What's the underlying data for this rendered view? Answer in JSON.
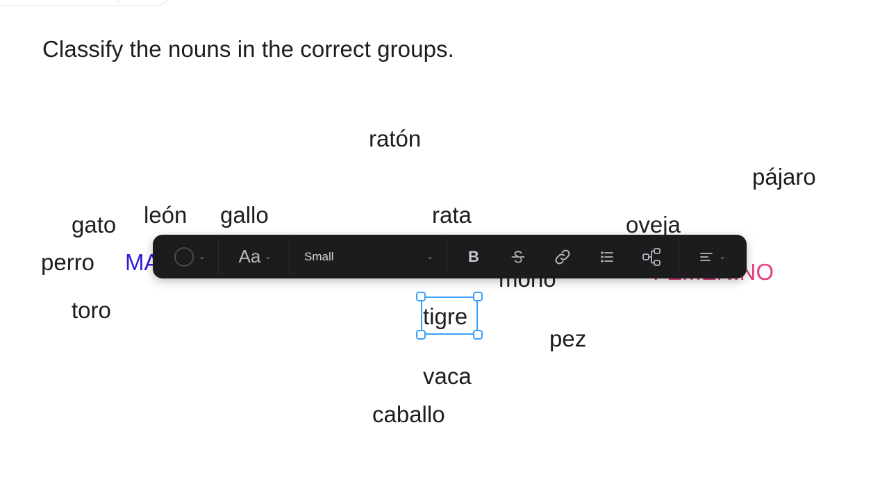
{
  "instructions": "Classify the nouns in the correct groups.",
  "words": {
    "raton": "ratón",
    "pajaro": "pájaro",
    "gato": "gato",
    "leon": "león",
    "gallo": "gallo",
    "rata": "rata",
    "oveja": "oveja",
    "perro": "perro",
    "mono": "mono",
    "toro": "toro",
    "tigre": "tigre",
    "pez": "pez",
    "vaca": "vaca",
    "caballo": "caballo"
  },
  "categories": {
    "masculine_visible": "MA",
    "feminine_visible": "FEMENINO"
  },
  "toolbar": {
    "font_label": "Aa",
    "size_label": "Small",
    "bold_label": "B"
  },
  "icons": {
    "color": "color-circle-icon",
    "strike": "strikethrough-icon",
    "link": "link-icon",
    "list": "bulleted-list-icon",
    "diagram": "diagram-icon",
    "align": "align-left-icon",
    "chevron": "chevron-down-icon"
  },
  "colors": {
    "masculine": "#2f1dd6",
    "feminine": "#e3407f",
    "selection": "#3aa0ff",
    "toolbar_bg": "#1c1c1e"
  }
}
